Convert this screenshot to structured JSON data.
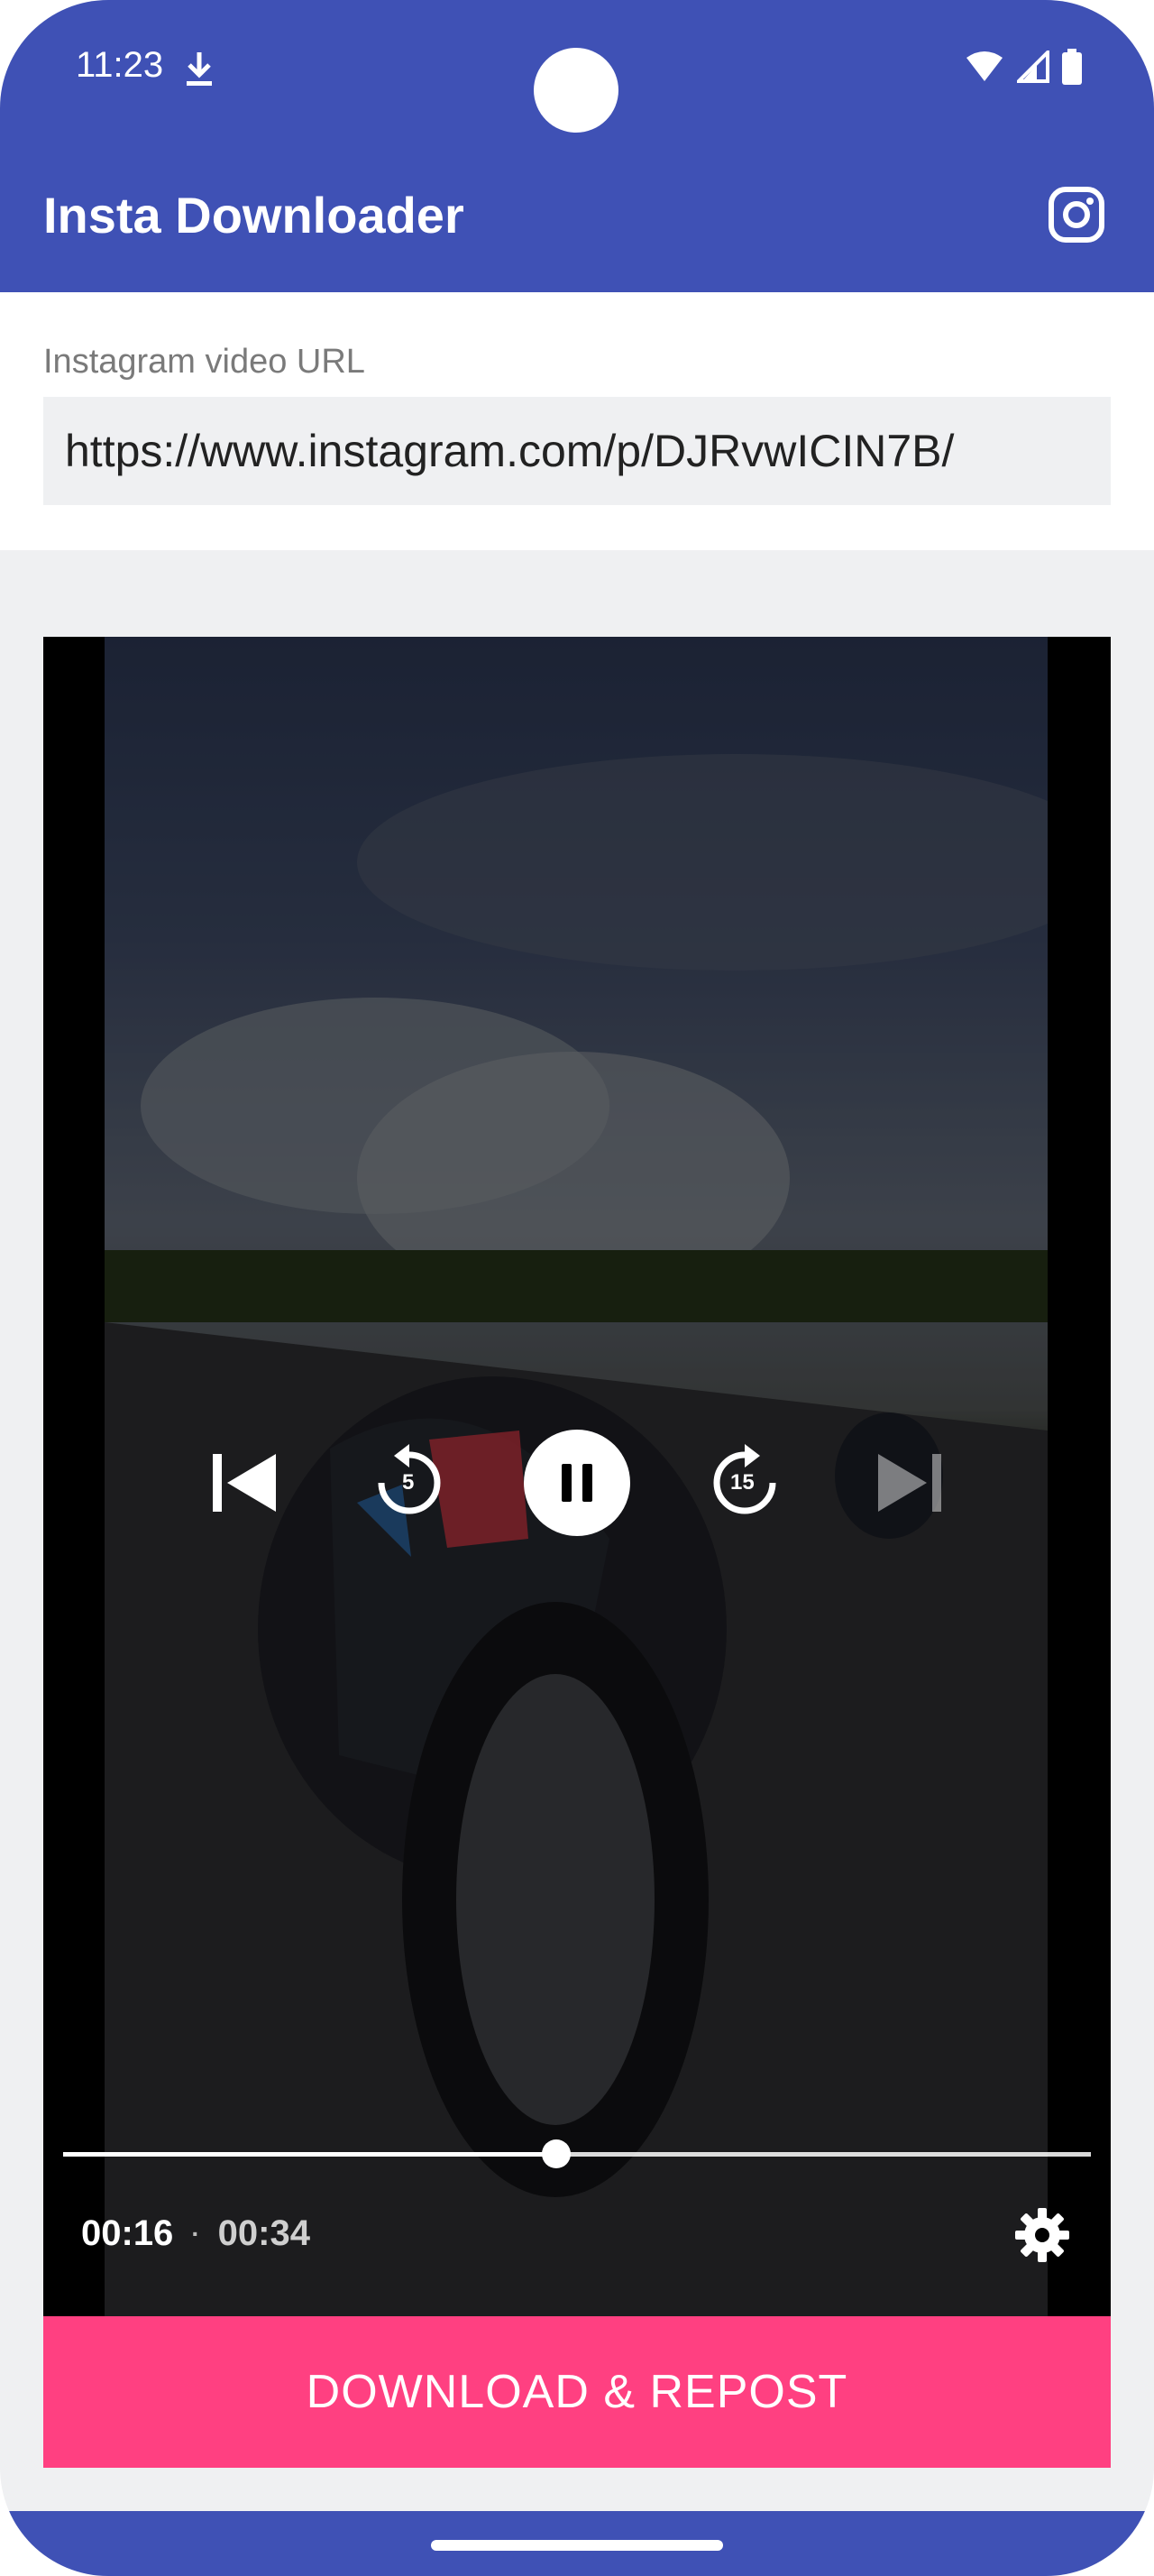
{
  "status_bar": {
    "time": "11:23",
    "icons": [
      "download-icon",
      "wifi-icon",
      "signal-icon",
      "battery-icon"
    ]
  },
  "app_bar": {
    "title": "Insta Downloader",
    "action_icon": "instagram-icon",
    "color": "#3f51b5"
  },
  "url_form": {
    "label": "Instagram video URL",
    "value": "https://www.instagram.com/p/DJRvwICIN7B/"
  },
  "player": {
    "controls": [
      "previous-icon",
      "rewind-5-icon",
      "pause-icon",
      "forward-15-icon",
      "next-icon"
    ],
    "rewind_label": "5",
    "forward_label": "15",
    "position": "00:16",
    "separator": "·",
    "duration": "00:34",
    "progress_fraction": 0.48
  },
  "actions": {
    "download_label": "DOWNLOAD & REPOST",
    "accent": "#ff4081"
  }
}
